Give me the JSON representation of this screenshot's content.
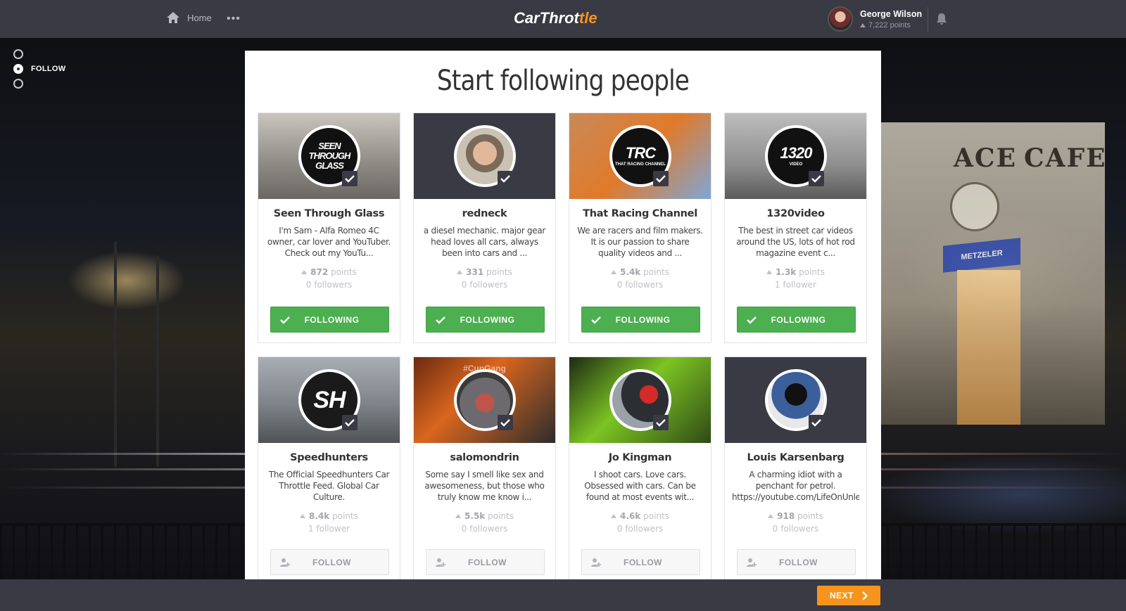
{
  "header": {
    "home_label": "Home",
    "more_label": "•••",
    "logo_main": "CarThrot",
    "logo_accent": "tle",
    "user_name": "George Wilson",
    "user_points": "7,222 points"
  },
  "steps": {
    "active_label": "FOLLOW"
  },
  "page": {
    "title": "Start following people"
  },
  "cards": [
    {
      "name": "Seen Through Glass",
      "desc": "I'm Sam - Alfa Romeo 4C owner, car lover and YouTuber. Check out my YouTu...",
      "points": "872",
      "points_label": "points",
      "followers": "0 followers",
      "button": "FOLLOWING",
      "state": "following",
      "badge": "SEEN THROUGH GLASS"
    },
    {
      "name": "redneck",
      "desc": "a diesel mechanic. major gear head loves all cars, always been into cars and ...",
      "points": "331",
      "points_label": "points",
      "followers": "0 followers",
      "button": "FOLLOWING",
      "state": "following",
      "badge": ""
    },
    {
      "name": "That Racing Channel",
      "desc": "We are racers and film makers. It is our passion to share quality videos and ...",
      "points": "5.4k",
      "points_label": "points",
      "followers": "0 followers",
      "button": "FOLLOWING",
      "state": "following",
      "badge": "TRC",
      "badge_sub": "THAT RACING CHANNEL"
    },
    {
      "name": "1320video",
      "desc": "The best in street car videos around the US, lots of hot rod magazine event c...",
      "points": "1.3k",
      "points_label": "points",
      "followers": "1 follower",
      "button": "FOLLOWING",
      "state": "following",
      "badge": "1320",
      "badge_sub": "VIDEO"
    },
    {
      "name": "Speedhunters",
      "desc": "The Official Speedhunters Car Throttle Feed. Global Car Culture.",
      "points": "8.4k",
      "points_label": "points",
      "followers": "1 follower",
      "button": "FOLLOW",
      "state": "follow",
      "badge": "SH"
    },
    {
      "name": "salomondrin",
      "desc": "Some say I smell like sex and awesomeness, but those who truly know me know i...",
      "points": "5.5k",
      "points_label": "points",
      "followers": "0 followers",
      "button": "FOLLOW",
      "state": "follow",
      "badge": "",
      "cover_text": "#CupGang"
    },
    {
      "name": "Jo Kingman",
      "desc": "I shoot cars. Love cars. Obsessed with cars. Can be found at most events wit...",
      "points": "4.6k",
      "points_label": "points",
      "followers": "0 followers",
      "button": "FOLLOW",
      "state": "follow",
      "badge": ""
    },
    {
      "name": "Louis Karsenbarg",
      "desc": "A charming idiot with a penchant for petrol. https://youtube.com/LifeOnUnlea...",
      "points": "918",
      "points_label": "points",
      "followers": "0 followers",
      "button": "FOLLOW",
      "state": "follow",
      "badge": ""
    }
  ],
  "footer": {
    "next_label": "NEXT"
  },
  "colors": {
    "topbar": "#3a3a44",
    "following_green": "#4caf50",
    "next_orange": "#f7941d",
    "logo_orange": "#f7941d"
  },
  "background_signs": {
    "cafe_left": "ACE",
    "cafe_right": "CAFE",
    "shop_sign": "METZELER"
  }
}
